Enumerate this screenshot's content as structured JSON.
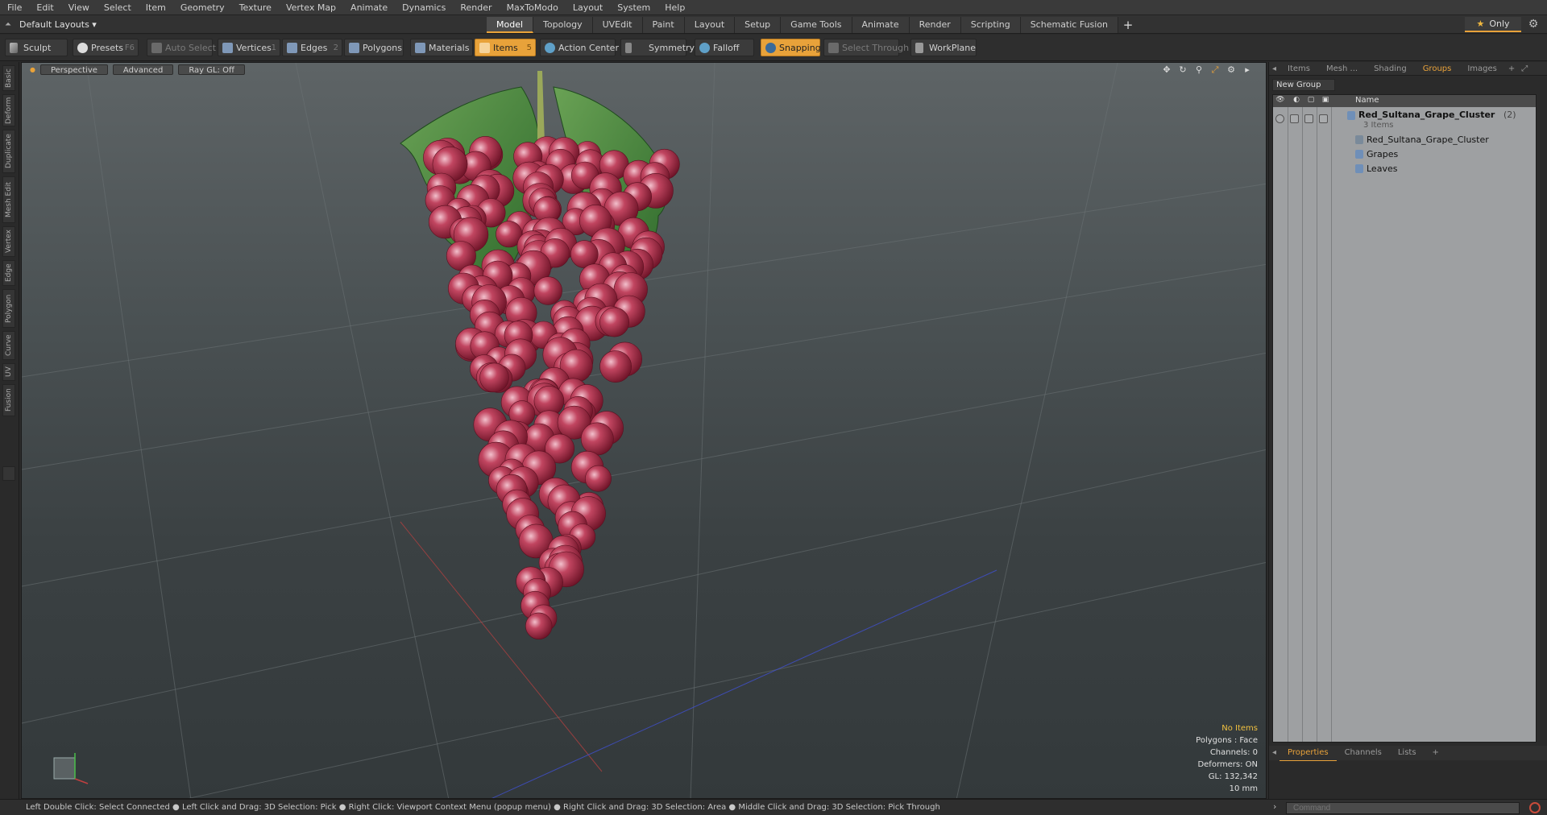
{
  "menu": [
    "File",
    "Edit",
    "View",
    "Select",
    "Item",
    "Geometry",
    "Texture",
    "Vertex Map",
    "Animate",
    "Dynamics",
    "Render",
    "MaxToModo",
    "Layout",
    "System",
    "Help"
  ],
  "layout": {
    "current": "Default Layouts ▾"
  },
  "tabs": [
    "Model",
    "Topology",
    "UVEdit",
    "Paint",
    "Layout",
    "Setup",
    "Game Tools",
    "Animate",
    "Render",
    "Scripting",
    "Schematic Fusion"
  ],
  "active_tab": "Model",
  "only_label": "Only",
  "toolbar": {
    "sculpt": "Sculpt",
    "presets": "Presets",
    "presets_key": "F6",
    "auto_select": "Auto Select",
    "vertices": "Vertices",
    "vertices_count": "1",
    "edges": "Edges",
    "edges_count": "2",
    "polygons": "Polygons",
    "materials": "Materials",
    "items": "Items",
    "items_count": "5",
    "action_center": "Action Center",
    "symmetry": "Symmetry",
    "falloff": "Falloff",
    "snapping": "Snapping",
    "select_through": "Select Through",
    "workplane": "WorkPlane"
  },
  "left_tabs": [
    "Basic",
    "Deform",
    "Duplicate",
    "Mesh Edit",
    "Vertex",
    "Edge",
    "Polygon",
    "Curve",
    "UV",
    "Fusion"
  ],
  "viewport": {
    "view": "Perspective",
    "mode": "Advanced",
    "raygl": "Ray GL: Off",
    "stats": {
      "selection": "No Items",
      "polygons": "Polygons : Face",
      "channels": "Channels: 0",
      "deformers": "Deformers: ON",
      "gl": "GL: 132,342",
      "scale": "10 mm"
    }
  },
  "right_panel": {
    "tabs": [
      "Items",
      "Mesh ...",
      "Shading",
      "Groups",
      "Images"
    ],
    "active_tab": "Groups",
    "new_group": "New Group",
    "column_name": "Name",
    "group": {
      "name": "Red_Sultana_Grape_Cluster",
      "count": "(2)",
      "subtitle": "3 Items"
    },
    "children": [
      "Red_Sultana_Grape_Cluster",
      "Grapes",
      "Leaves"
    ],
    "bottom_tabs": [
      "Properties",
      "Channels",
      "Lists"
    ],
    "active_bottom_tab": "Properties"
  },
  "statusbar": "Left Double Click: Select Connected ● Left Click and Drag: 3D Selection: Pick ● Right Click: Viewport Context Menu (popup menu) ● Right Click and Drag: 3D Selection: Area ● Middle Click and Drag: 3D Selection: Pick Through",
  "command_placeholder": "Command",
  "colors": {
    "accent": "#e8a23a",
    "grape": "#b0304a",
    "leaf": "#4d8a3a"
  }
}
